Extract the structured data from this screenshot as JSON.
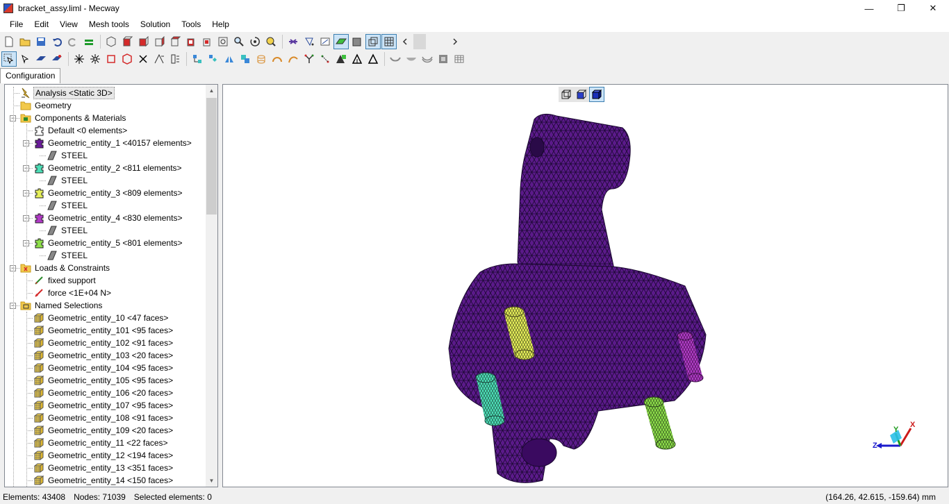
{
  "window": {
    "title": "bracket_assy.liml - Mecway",
    "minimize": "—",
    "maximize": "❐",
    "close": "✕"
  },
  "menu": [
    "File",
    "Edit",
    "View",
    "Mesh tools",
    "Solution",
    "Tools",
    "Help"
  ],
  "tabs": [
    {
      "label": "Configuration"
    }
  ],
  "tree": [
    {
      "label": "Analysis <Static 3D>",
      "icon": "analysis-icon",
      "level": 1,
      "selected": true
    },
    {
      "label": "Geometry",
      "icon": "folder-icon",
      "level": 1
    },
    {
      "label": "Components & Materials",
      "icon": "components-icon",
      "level": 1,
      "expander": "−"
    },
    {
      "label": "Default <0 elements>",
      "icon": "component-icon",
      "level": 2,
      "color": "#ffffff"
    },
    {
      "label": "Geometric_entity_1 <40157 elements>",
      "icon": "component-icon",
      "level": 2,
      "expander": "−",
      "color": "#6a1b9a"
    },
    {
      "label": "STEEL",
      "icon": "material-icon",
      "level": 3
    },
    {
      "label": "Geometric_entity_2 <811 elements>",
      "icon": "component-icon",
      "level": 2,
      "expander": "−",
      "color": "#4de0b8"
    },
    {
      "label": "STEEL",
      "icon": "material-icon",
      "level": 3
    },
    {
      "label": "Geometric_entity_3 <809 elements>",
      "icon": "component-icon",
      "level": 2,
      "expander": "−",
      "color": "#e6f05a"
    },
    {
      "label": "STEEL",
      "icon": "material-icon",
      "level": 3
    },
    {
      "label": "Geometric_entity_4 <830 elements>",
      "icon": "component-icon",
      "level": 2,
      "expander": "−",
      "color": "#b23ac8"
    },
    {
      "label": "STEEL",
      "icon": "material-icon",
      "level": 3
    },
    {
      "label": "Geometric_entity_5 <801 elements>",
      "icon": "component-icon",
      "level": 2,
      "expander": "−",
      "color": "#8ee04a"
    },
    {
      "label": "STEEL",
      "icon": "material-icon",
      "level": 3
    },
    {
      "label": "Loads & Constraints",
      "icon": "loads-folder-icon",
      "level": 1,
      "expander": "−"
    },
    {
      "label": "fixed support",
      "icon": "fixed-support-icon",
      "level": 2
    },
    {
      "label": "force <1E+04 N>",
      "icon": "force-icon",
      "level": 2
    },
    {
      "label": "Named Selections",
      "icon": "named-selections-icon",
      "level": 1,
      "expander": "−"
    },
    {
      "label": "Geometric_entity_10 <47 faces>",
      "icon": "selection-icon",
      "level": 2
    },
    {
      "label": "Geometric_entity_101 <95 faces>",
      "icon": "selection-icon",
      "level": 2
    },
    {
      "label": "Geometric_entity_102 <91 faces>",
      "icon": "selection-icon",
      "level": 2
    },
    {
      "label": "Geometric_entity_103 <20 faces>",
      "icon": "selection-icon",
      "level": 2
    },
    {
      "label": "Geometric_entity_104 <95 faces>",
      "icon": "selection-icon",
      "level": 2
    },
    {
      "label": "Geometric_entity_105 <95 faces>",
      "icon": "selection-icon",
      "level": 2
    },
    {
      "label": "Geometric_entity_106 <20 faces>",
      "icon": "selection-icon",
      "level": 2
    },
    {
      "label": "Geometric_entity_107 <95 faces>",
      "icon": "selection-icon",
      "level": 2
    },
    {
      "label": "Geometric_entity_108 <91 faces>",
      "icon": "selection-icon",
      "level": 2
    },
    {
      "label": "Geometric_entity_109 <20 faces>",
      "icon": "selection-icon",
      "level": 2
    },
    {
      "label": "Geometric_entity_11 <22 faces>",
      "icon": "selection-icon",
      "level": 2
    },
    {
      "label": "Geometric_entity_12 <194 faces>",
      "icon": "selection-icon",
      "level": 2
    },
    {
      "label": "Geometric_entity_13 <351 faces>",
      "icon": "selection-icon",
      "level": 2
    },
    {
      "label": "Geometric_entity_14 <150 faces>",
      "icon": "selection-icon",
      "level": 2
    }
  ],
  "scroll": {
    "up": "▲",
    "down": "▼"
  },
  "view_modes": [
    "wireframe-view-icon",
    "shaded-view-icon",
    "shaded-edges-view-icon"
  ],
  "status": {
    "elements": "Elements: 43408",
    "nodes": "Nodes: 71039",
    "selected": "Selected elements: 0",
    "coords": "(164.26, 42.615, -159.64) mm"
  },
  "triad": {
    "x": "X",
    "y": "Y",
    "z": "Z"
  },
  "colors": {
    "mesh_body": "#5b1a8a",
    "pin_yellow": "#e6f05a",
    "pin_teal": "#4de0b8",
    "pin_green": "#8ee04a",
    "pin_magenta": "#b23ac8",
    "selection_blue": "#cce4f7"
  }
}
